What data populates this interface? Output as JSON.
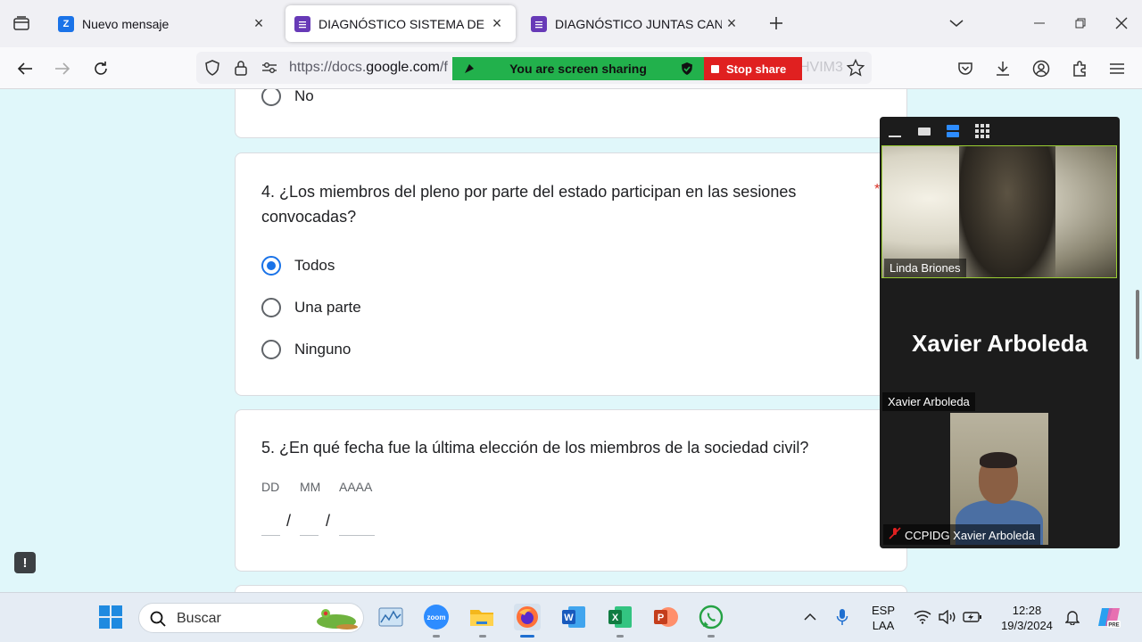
{
  "browser": {
    "tabs": [
      {
        "title": "Nuevo mensaje",
        "active": false,
        "favicon_color": "#1a73e8"
      },
      {
        "title": "DIAGNÓSTICO SISTEMA DE PRO",
        "active": true,
        "favicon_color": "#673ab7"
      },
      {
        "title": "DIAGNÓSTICO JUNTAS CANTON",
        "active": false,
        "favicon_color": "#673ab7"
      }
    ],
    "url_prefix": "https://docs.",
    "url_host": "google.com",
    "url_rest": "/f",
    "url_tail": "HVIM3",
    "share_banner": "You are screen sharing",
    "stop_share": "Stop share"
  },
  "form": {
    "prev_option": "No",
    "q4": {
      "text": "4.  ¿Los miembros del pleno por parte del estado participan en las sesiones convocadas?",
      "required_mark": "*",
      "options": [
        {
          "label": "Todos",
          "checked": true
        },
        {
          "label": "Una parte",
          "checked": false
        },
        {
          "label": "Ninguno",
          "checked": false
        }
      ]
    },
    "q5": {
      "text": "5. ¿En qué fecha fue la última elección de los miembros de la sociedad civil?",
      "day_label": "DD",
      "month_label": "MM",
      "year_label": "AAAA",
      "separator": "/"
    },
    "feedback_label": "!"
  },
  "zoom": {
    "participants": [
      {
        "name": "Linda Briones"
      },
      {
        "name": "Xavier Arboleda",
        "display_name": "Xavier Arboleda"
      },
      {
        "name": "CCPIDG Xavier Arboleda",
        "muted": true
      }
    ],
    "accent": "#9acd32"
  },
  "taskbar": {
    "search_placeholder": "Buscar",
    "lang_top": "ESP",
    "lang_bottom": "LAA",
    "time": "12:28",
    "date": "19/3/2024",
    "apps": [
      "widgets",
      "zoom",
      "file-explorer",
      "firefox",
      "word",
      "excel",
      "powerpoint",
      "whatsapp"
    ]
  }
}
